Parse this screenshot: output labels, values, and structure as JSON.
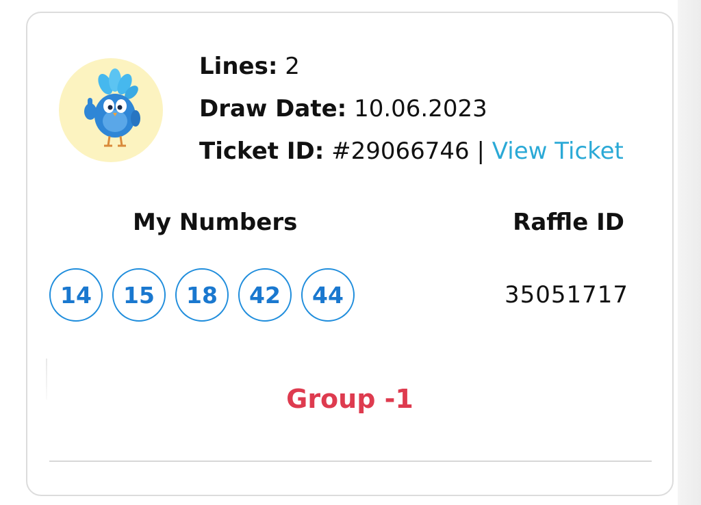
{
  "ticket": {
    "lines_label": "Lines:",
    "lines_value": "2",
    "draw_date_label": "Draw Date:",
    "draw_date_value": "10.06.2023",
    "ticket_id_label": "Ticket ID:",
    "ticket_id_value": "#29066746",
    "separator": "|",
    "view_ticket_label": "View Ticket"
  },
  "numbers": {
    "heading": "My Numbers",
    "balls": [
      "14",
      "15",
      "18",
      "42",
      "44"
    ]
  },
  "raffle": {
    "heading": "Raffle ID",
    "value": "35051717"
  },
  "group_label": "Group -1",
  "colors": {
    "link": "#2aa9d6",
    "ball_border": "#1f8ddc",
    "ball_text": "#1a78cf",
    "group_text": "#de3b4f",
    "avatar_bg": "#fcf3c0"
  },
  "icons": {
    "avatar": "blue-bird-mascot-thumbs-up"
  }
}
